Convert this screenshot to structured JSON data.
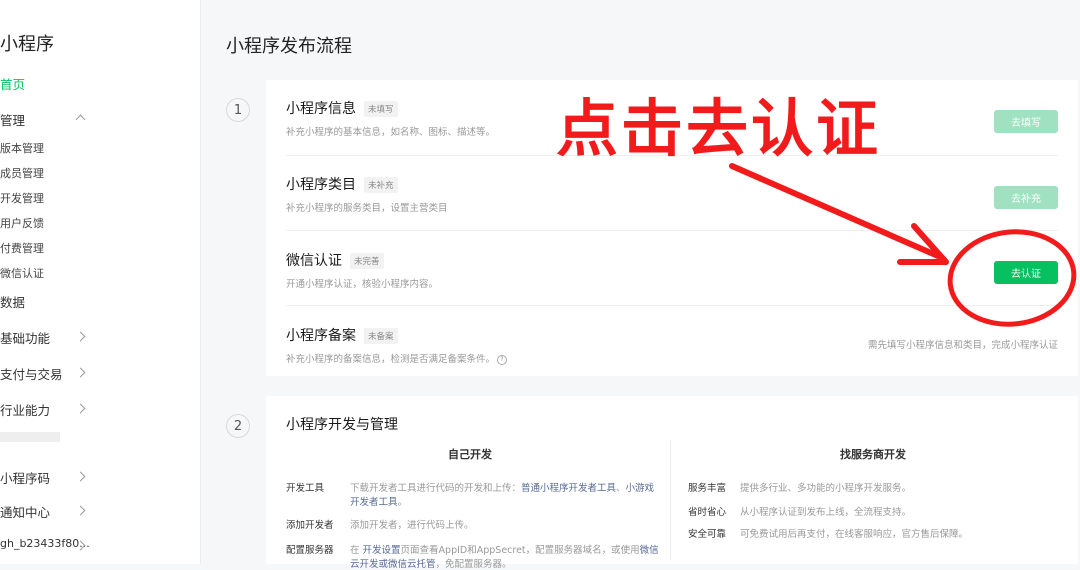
{
  "sidebar": {
    "app_title": "小程序",
    "items": [
      {
        "label": "首页"
      },
      {
        "label": "管理"
      },
      {
        "label": "版本管理"
      },
      {
        "label": "成员管理"
      },
      {
        "label": "开发管理"
      },
      {
        "label": "用户反馈"
      },
      {
        "label": "付费管理"
      },
      {
        "label": "微信认证"
      },
      {
        "label": "数据"
      },
      {
        "label": "基础功能"
      },
      {
        "label": "支付与交易"
      },
      {
        "label": "行业能力"
      },
      {
        "label": "小程序码"
      },
      {
        "label": "通知中心"
      },
      {
        "label": "gh_b23433f80..."
      }
    ]
  },
  "main": {
    "page_title": "小程序发布流程",
    "step1": {
      "number": "1",
      "rows": [
        {
          "title": "小程序信息",
          "tag": "未填写",
          "desc": "补充小程序的基本信息，如名称、图标、描述等。",
          "button": "去填写"
        },
        {
          "title": "小程序类目",
          "tag": "未补充",
          "desc": "补充小程序的服务类目，设置主营类目",
          "button": "去补充"
        },
        {
          "title": "微信认证",
          "tag": "未完善",
          "desc": "开通小程序认证，核验小程序内容。",
          "button": "去认证"
        },
        {
          "title": "小程序备案",
          "tag": "未备案",
          "desc": "补充小程序的备案信息，检测是否满足备案条件。",
          "hint": "需先填写小程序信息和类目，完成小程序认证"
        }
      ]
    },
    "step2": {
      "number": "2",
      "title": "小程序开发与管理",
      "self_dev": {
        "heading": "自己开发",
        "items": [
          {
            "key": "开发工具",
            "value_pre": "下载开发者工具进行代码的开发和上传：",
            "link1": "普通小程序开发者工具",
            "sep": "、",
            "link2": "小游戏",
            "line2": "开发者工具",
            "line2_end": "。"
          },
          {
            "key": "添加开发者",
            "value": "添加开发者，进行代码上传。"
          },
          {
            "key": "配置服务器",
            "value_pre": "在 ",
            "link1": "开发设置",
            "value_mid": "页面查看AppID和AppSecret，配置服务器域名，或使用",
            "link2": "微信",
            "line2_link": "云开发或微信云托管",
            "line2_end": "，免配置服务器。"
          }
        ]
      },
      "provider_dev": {
        "heading": "找服务商开发",
        "items": [
          {
            "key": "服务丰富",
            "value": "提供多行业、多功能的小程序开发服务。"
          },
          {
            "key": "省时省心",
            "value": "从小程序认证到发布上线，全流程支持。"
          },
          {
            "key": "安全可靠",
            "value": "可免费试用后再支付，在线客服响应，官方售后保障。"
          }
        ]
      }
    }
  },
  "annotation": {
    "text": "点击去认证",
    "color": "#f21b1b"
  },
  "colors": {
    "accent": "#07c160",
    "accent_disabled": "#9fe1c0",
    "link": "#576b95"
  }
}
